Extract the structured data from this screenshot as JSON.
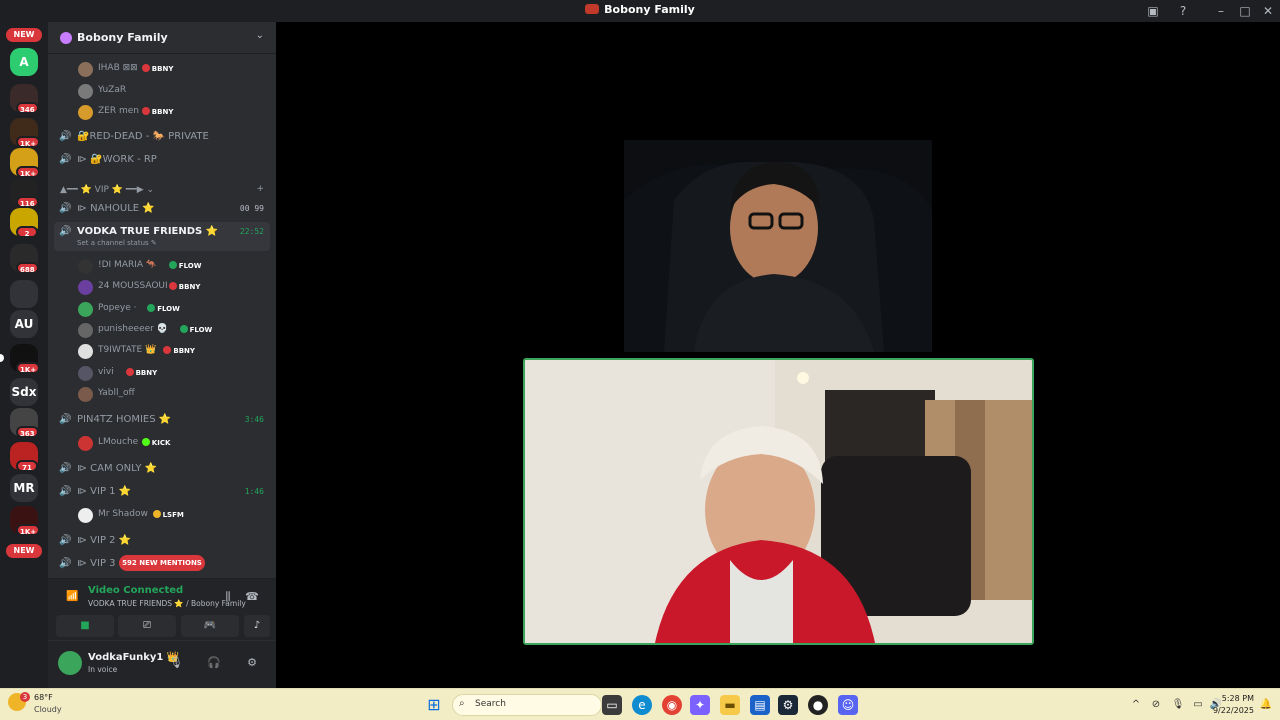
{
  "window": {
    "title": "Bobony Family"
  },
  "servers": [
    {
      "label": "NEW",
      "kind": "pill"
    },
    {
      "label": "A",
      "badge": ""
    },
    {
      "label": "",
      "badge": "346"
    },
    {
      "label": "",
      "badge": "1K+"
    },
    {
      "label": "",
      "badge": "1K+"
    },
    {
      "label": "",
      "badge": "116"
    },
    {
      "label": "",
      "badge": "2"
    },
    {
      "label": "",
      "badge": "688"
    },
    {
      "label": "",
      "badge": ""
    },
    {
      "label": "AU",
      "badge": ""
    },
    {
      "label": "",
      "badge": "1K+"
    },
    {
      "label": "Sdx",
      "badge": ""
    },
    {
      "label": "",
      "badge": "363"
    },
    {
      "label": "",
      "badge": "71"
    },
    {
      "label": "MR",
      "badge": ""
    },
    {
      "label": "",
      "badge": "1K+"
    },
    {
      "label": "NEW",
      "kind": "pill"
    }
  ],
  "guild": {
    "name": "Bobony Family"
  },
  "channel_list": {
    "top_users": [
      {
        "name": "IHAB ⊠⊠",
        "tag": "BBNY"
      },
      {
        "name": "YuZaR",
        "tag": ""
      },
      {
        "name": "ZER men",
        "tag": "BBNY"
      }
    ],
    "channels_a": [
      {
        "name": "🔐RED-DEAD - 🐎 PRIVATE"
      },
      {
        "name": "⧐ 🔐WORK - RP"
      }
    ],
    "category": "▲━━ ⭐ VIP ⭐ ━━▶ ⌄",
    "nahoule": {
      "name": "⧐ NAHOULE ⭐",
      "counts": "00 99"
    },
    "active": {
      "name": "VODKA TRUE FRIENDS ⭐",
      "time": "22:52",
      "status": "Set a channel status ✎"
    },
    "active_users": [
      {
        "name": "!DI MARIA 🦘",
        "tag": "FLOW"
      },
      {
        "name": "24 MOUSSAOUI",
        "tag": "BBNY"
      },
      {
        "name": "Popeye ·",
        "tag": "FLOW"
      },
      {
        "name": "punisheeeer 💀",
        "tag": "FLOW"
      },
      {
        "name": "T9IWTATE 👑",
        "tag": "BBNY"
      },
      {
        "name": "vivi",
        "tag": "BBNY"
      },
      {
        "name": "Yabll_off",
        "tag": ""
      }
    ],
    "pin4tz": {
      "name": "PIN4TZ HOMIES ⭐",
      "time": "3:46"
    },
    "pin4tz_user": {
      "name": "LMouche",
      "tag": "KICK"
    },
    "cam_only": {
      "name": "⧐ CAM ONLY ⭐"
    },
    "vip1": {
      "name": "⧐ VIP 1 ⭐",
      "time": "1:46"
    },
    "vip1_user": {
      "name": "Mr Shadow",
      "tag": "LSFM"
    },
    "vip2": {
      "name": "⧐ VIP 2 ⭐"
    },
    "vip3": {
      "name": "⧐ VIP 3"
    },
    "mentions": "592 NEW MENTIONS"
  },
  "voice": {
    "status": "Video Connected",
    "channel": "VODKA TRUE FRIENDS ⭐ / Bobony Family"
  },
  "user": {
    "name": "VodkaFunky1 👑",
    "status": "In voice"
  },
  "taskbar": {
    "weather_temp": "68°F",
    "weather_cond": "Cloudy",
    "weather_badge": "3",
    "search": "Search",
    "time": "5:28 PM",
    "date": "9/22/2025"
  },
  "colors": {
    "accent": "#23a55a",
    "danger": "#da373c",
    "bg": "#2b2d31"
  }
}
